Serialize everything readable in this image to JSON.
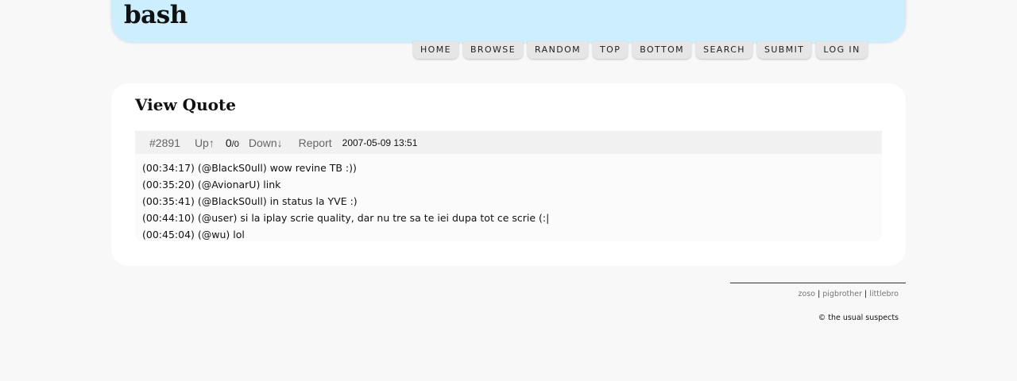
{
  "site": {
    "logo": "bash"
  },
  "nav": [
    "HOME",
    "BROWSE",
    "RANDOM",
    "TOP",
    "BOTTOM",
    "SEARCH",
    "SUBMIT",
    "LOG IN"
  ],
  "page": {
    "title": "View Quote"
  },
  "quote": {
    "id": "#2891",
    "up_label": "Up↑",
    "score": "0",
    "score_sep": "/",
    "votes": "0",
    "down_label": "Down↓",
    "report_label": "Report",
    "date": "2007-05-09 13:51",
    "lines": [
      "(00:34:17) (@BlackS0ull) wow revine TB :))",
      "(00:35:20) (@AvionarU) link",
      "(00:35:41) (@BlackS0ull) in status la YVE :)",
      "(00:44:10) (@user) si la iplay scrie quality, dar nu tre sa te iei dupa tot ce scrie (:|",
      "(00:45:04) (@wu) lol"
    ]
  },
  "footer": {
    "links": [
      "zoso",
      "pigbrother",
      "littlebro"
    ],
    "separator": "|",
    "copyright": "© the usual suspects"
  }
}
